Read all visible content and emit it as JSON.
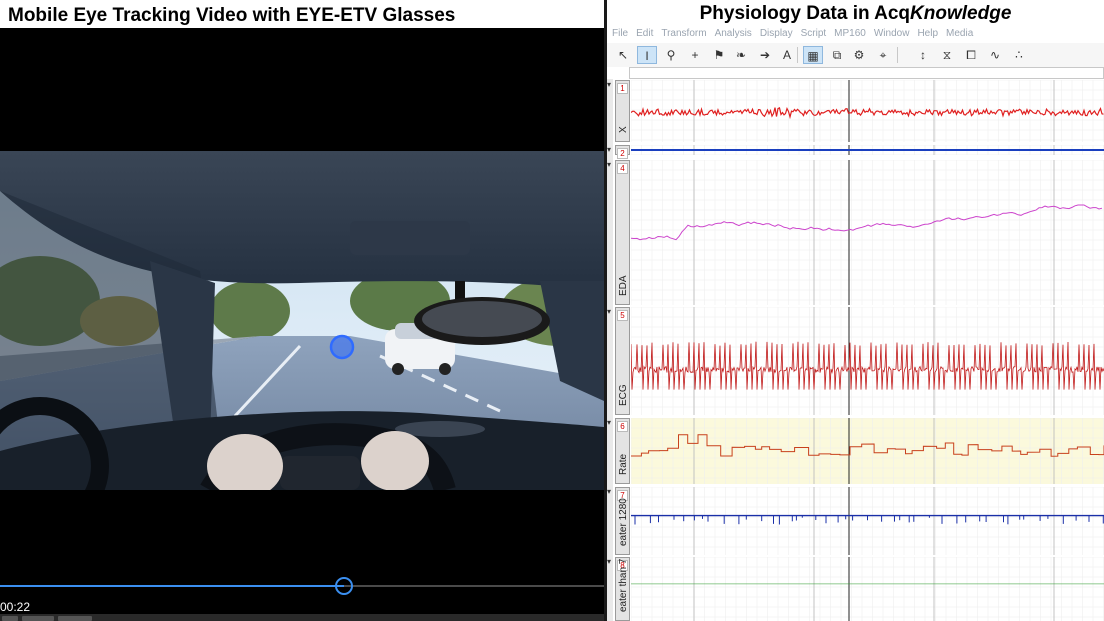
{
  "left_panel": {
    "title": "Mobile Eye Tracking Video with EYE-ETV Glasses",
    "timestamp": "00:22",
    "playback_progress": 0.57,
    "accent_color": "#3b8ff0",
    "gaze_marker_color": "#2f6bff"
  },
  "right_panel": {
    "title_prefix": "Physiology Data in Acq",
    "title_suffix": "Knowledge",
    "menu": [
      "File",
      "Edit",
      "Transform",
      "Analysis",
      "Display",
      "Script",
      "MP160",
      "Window",
      "Help",
      "Media"
    ],
    "toolbar_icons": [
      "pointer-icon",
      "i-beam-icon",
      "zoom-icon",
      "crosshair-icon",
      "flag-icon",
      "event-icon",
      "arrow-right-icon",
      "text-icon",
      "grid-icon",
      "overlap-icon",
      "gear-icon",
      "scale-icon",
      "autoscale-icon",
      "overlap-segments-icon",
      "fit-icon",
      "waveform-icon",
      "baseline-icon"
    ],
    "channels": [
      {
        "num": "1",
        "name": "X",
        "color": "#e02020"
      },
      {
        "num": "2",
        "name": "",
        "color": "#1a3fbf"
      },
      {
        "num": "4",
        "name": "EDA",
        "color": "#cc44cc"
      },
      {
        "num": "5",
        "name": "ECG",
        "color": "#c01818"
      },
      {
        "num": "6",
        "name": "Rate",
        "color": "#c8401c"
      },
      {
        "num": "7",
        "name": "eater 1280",
        "color": "#1a2fa8"
      },
      {
        "num": "8",
        "name": "eater than 7",
        "color": "#2a9a2a"
      }
    ]
  }
}
